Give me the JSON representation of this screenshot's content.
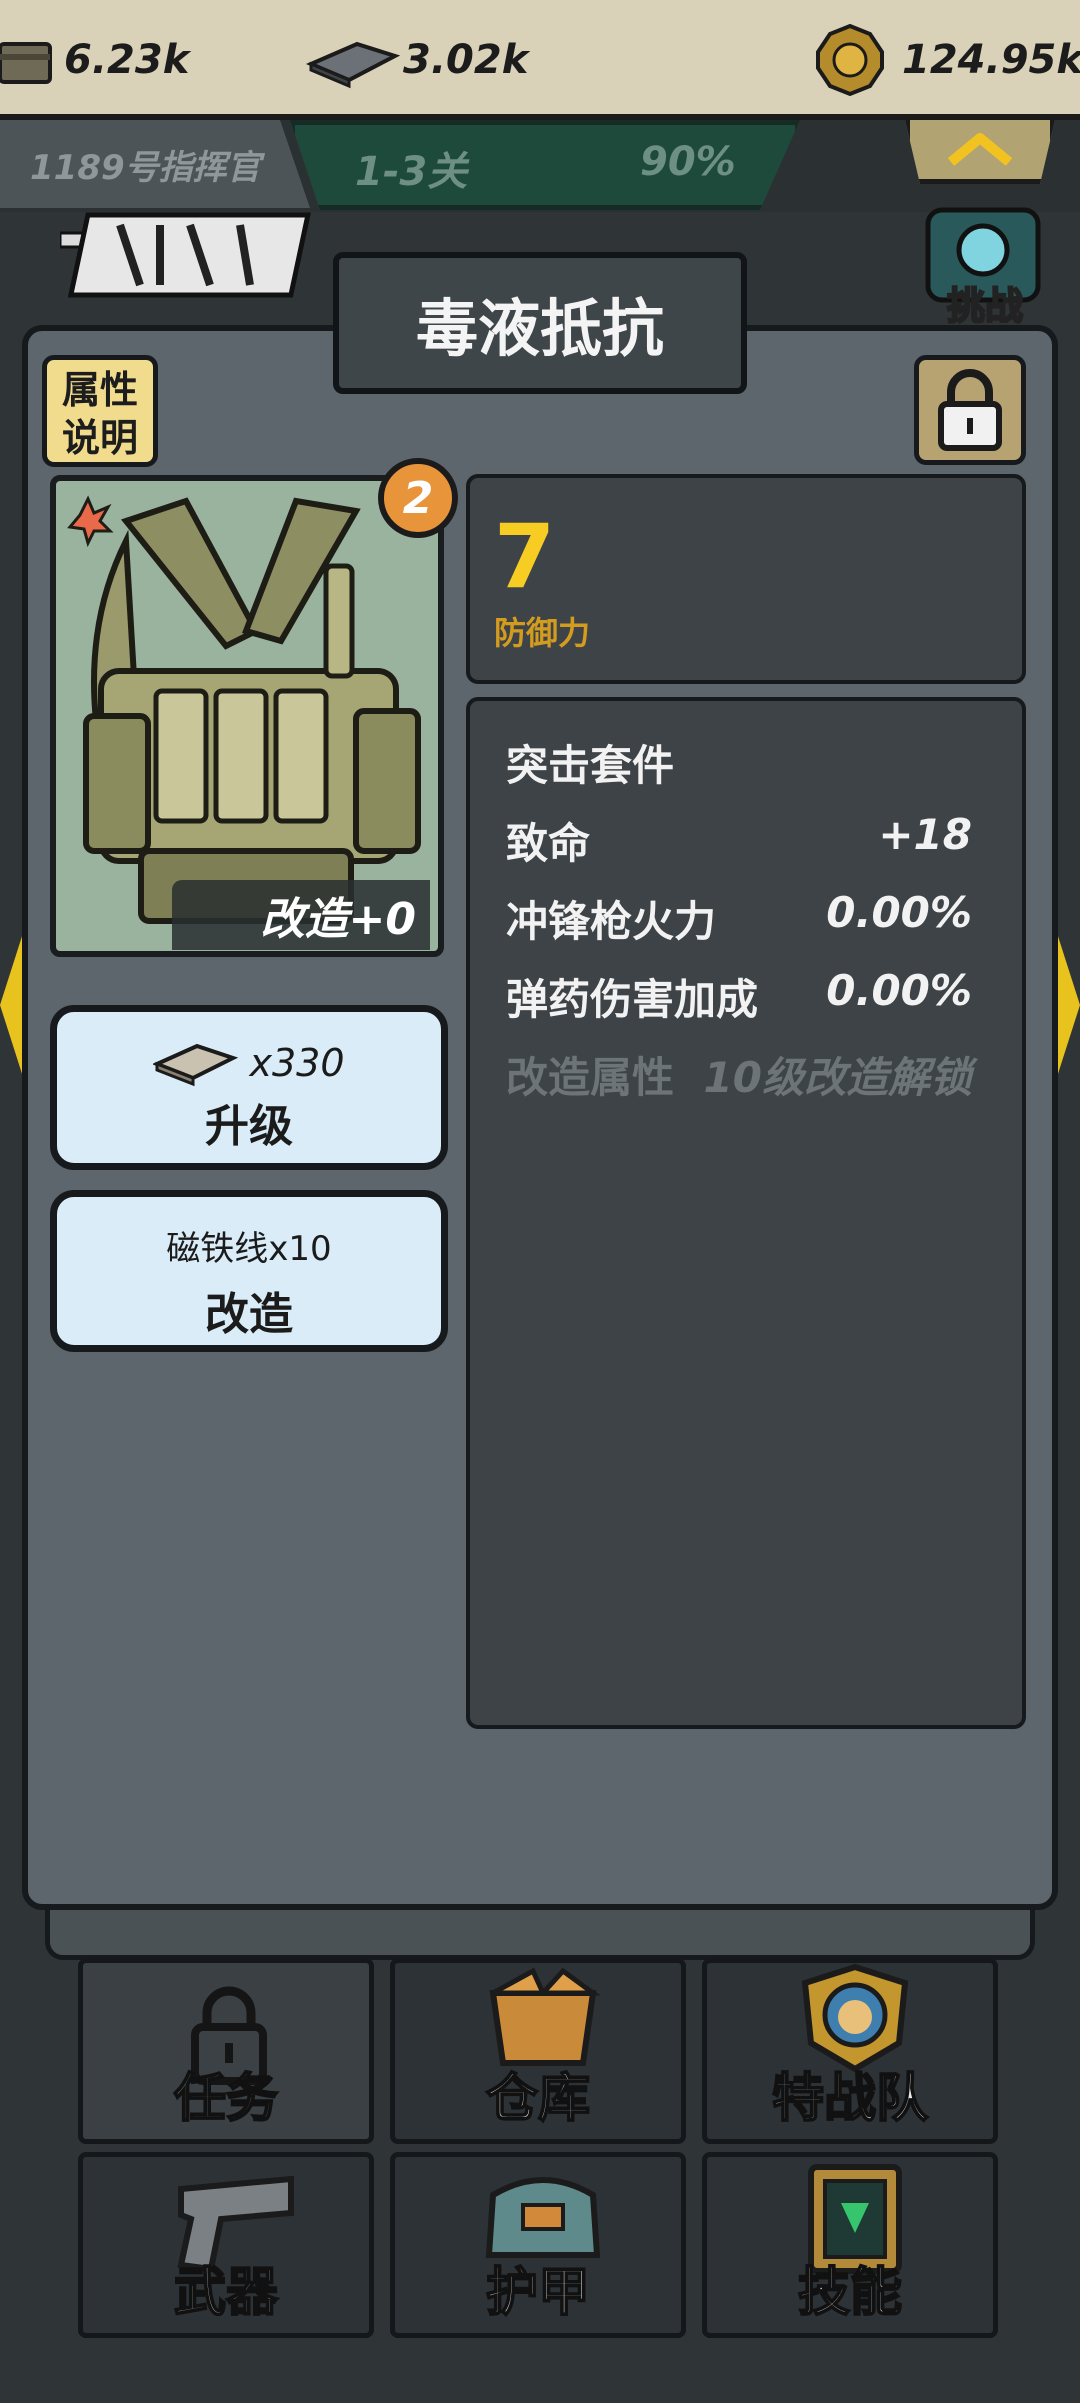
{
  "top_bar": {
    "resource_1": "6.23k",
    "resource_2": "3.02k",
    "resource_3": "124.95k"
  },
  "sub_bar": {
    "commander": "1189号指挥官",
    "stage": "1-3关",
    "progress": "90%"
  },
  "challenge": {
    "label": "挑战"
  },
  "modal": {
    "title": "毒液抵抗",
    "info_button": {
      "line1": "属性",
      "line2": "说明"
    },
    "item": {
      "level_badge": "2",
      "mod_label": "改造+0"
    },
    "defense": {
      "value": "7",
      "label": "防御力"
    },
    "upgrade_button": {
      "cost": "x330",
      "label": "升级"
    },
    "modify_button": {
      "cost": "磁铁线x10",
      "label": "改造"
    },
    "stats": {
      "set_name": "突击套件",
      "rows": [
        {
          "name": "致命",
          "value": "+18"
        },
        {
          "name": "冲锋枪火力",
          "value": "0.00%"
        },
        {
          "name": "弹药伤害加成",
          "value": "0.00%"
        }
      ],
      "locked_row": {
        "name": "改造属性",
        "value": "10级改造解锁"
      }
    }
  },
  "bottom_nav": {
    "row1": [
      {
        "label": "任务"
      },
      {
        "label": "仓库"
      },
      {
        "label": "特战队"
      }
    ],
    "row2": [
      {
        "label": "武器"
      },
      {
        "label": "护甲"
      },
      {
        "label": "技能"
      }
    ]
  },
  "colors": {
    "modal_bg": "#5c666c",
    "panel_bg": "#3d4347",
    "defense_value": "#f7cd24",
    "button_bg": "#d9ecf7"
  }
}
